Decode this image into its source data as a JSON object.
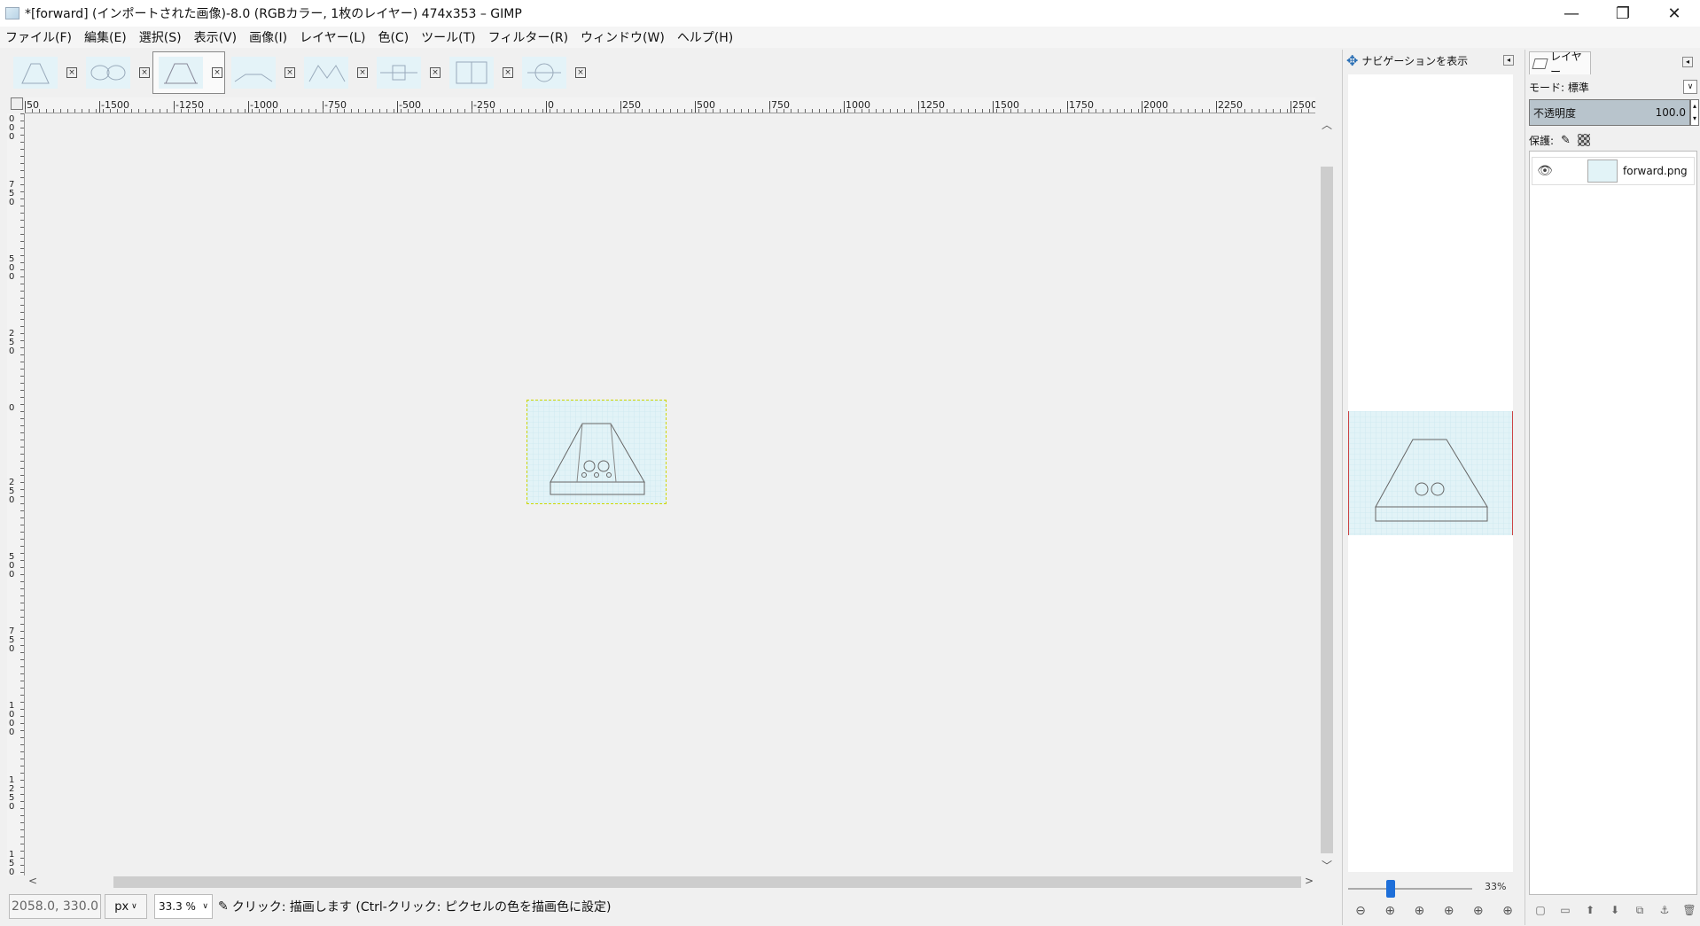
{
  "window": {
    "title": "*[forward] (インポートされた画像)-8.0 (RGBカラー, 1枚のレイヤー) 474x353 – GIMP",
    "minimize": "—",
    "maximize": "❐",
    "close": "✕"
  },
  "menu": [
    {
      "id": "file",
      "label": "ファイル(F)"
    },
    {
      "id": "edit",
      "label": "編集(E)"
    },
    {
      "id": "select",
      "label": "選択(S)"
    },
    {
      "id": "view",
      "label": "表示(V)"
    },
    {
      "id": "image",
      "label": "画像(I)"
    },
    {
      "id": "layer",
      "label": "レイヤー(L)"
    },
    {
      "id": "colors",
      "label": "色(C)"
    },
    {
      "id": "tools",
      "label": "ツール(T)"
    },
    {
      "id": "filters",
      "label": "フィルター(R)"
    },
    {
      "id": "windows",
      "label": "ウィンドウ(W)"
    },
    {
      "id": "help",
      "label": "ヘルプ(H)"
    }
  ],
  "image_tabs": [
    {
      "active": false,
      "close": "×"
    },
    {
      "active": false,
      "close": "×"
    },
    {
      "active": true,
      "close": "×"
    },
    {
      "active": false,
      "close": "×"
    },
    {
      "active": false,
      "close": "×"
    },
    {
      "active": false,
      "close": "×"
    },
    {
      "active": false,
      "close": "×"
    },
    {
      "active": false,
      "close": "×"
    }
  ],
  "ruler_h_labels": [
    "50",
    "-1500",
    "-1250",
    "-1000",
    "-750",
    "-500",
    "-250",
    "0",
    "250",
    "500",
    "750",
    "1000",
    "1250",
    "1500",
    "1750",
    "2000",
    "2250",
    "2500"
  ],
  "ruler_v_labels": [
    "1000",
    "750",
    "500",
    "250",
    "0",
    "250",
    "500",
    "750",
    "1000",
    "1250",
    "1500"
  ],
  "statusbar": {
    "coords": "2058.0, 330.0",
    "unit": "px",
    "zoom": "33.3 %",
    "message": "クリック: 描画します (Ctrl-クリック: ピクセルの色を描画色に設定)"
  },
  "navigation": {
    "tab_label": "ナビゲーションを表示",
    "zoom_label": "33%",
    "zoom_fraction": 0.33
  },
  "layers": {
    "tab_label": "レイヤー",
    "mode_label": "モード: 標準",
    "opacity_label": "不透明度",
    "opacity_value": "100.0",
    "lock_label": "保護:",
    "items": [
      {
        "name": "forward.png",
        "visible": true
      }
    ]
  },
  "colors": {
    "canvas_bg": "#f0f0f0",
    "image_bg": "#e2f3f7",
    "accent": "#1e6fd9"
  }
}
